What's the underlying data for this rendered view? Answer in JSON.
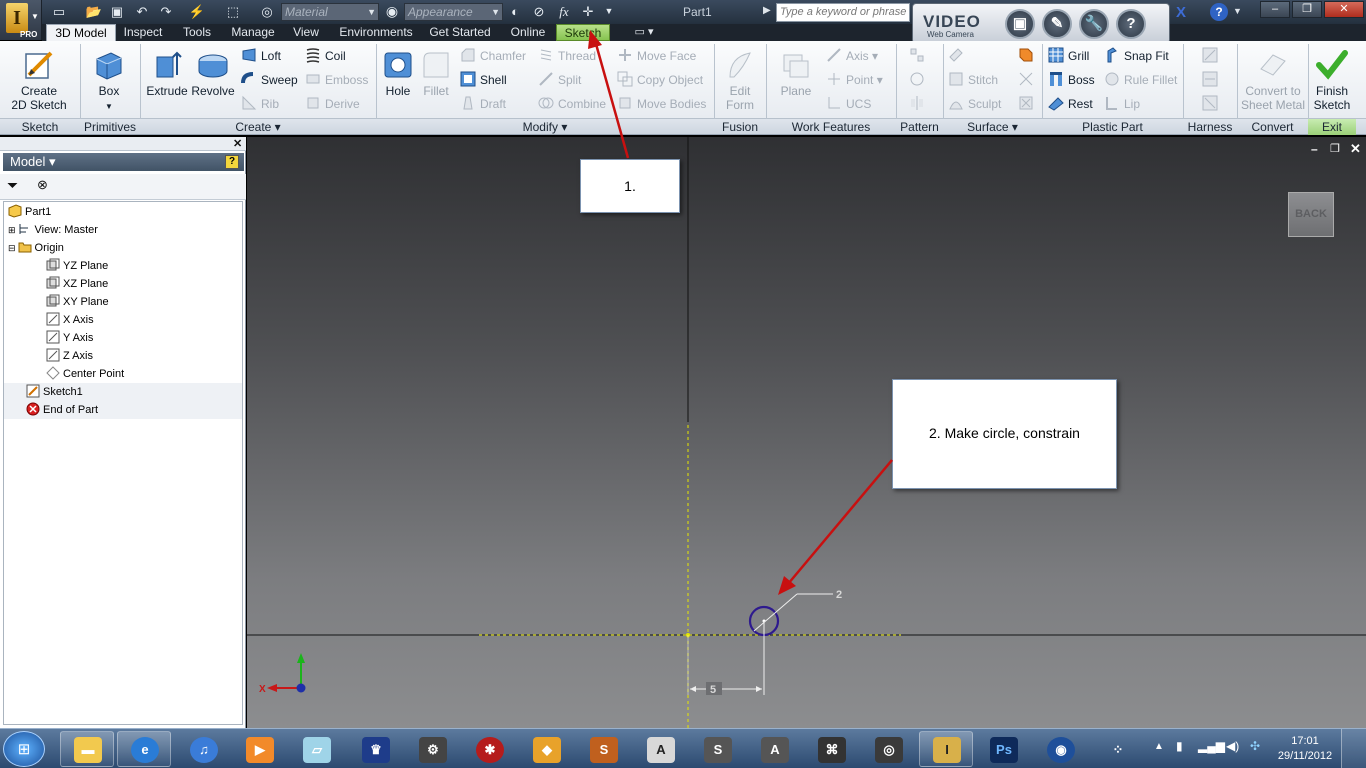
{
  "title_bar": {
    "document_title": "Part1",
    "material_combo": "Material",
    "appearance_combo": "Appearance",
    "fx_label": "fx",
    "search_placeholder": "Type a keyword or phrase"
  },
  "app_badge": {
    "letter": "I",
    "edition": "PRO"
  },
  "video_widget": {
    "title": "VIDEO",
    "subtitle": "Web Camera",
    "help_glyph": "?"
  },
  "tabs": [
    {
      "label": "3D Model",
      "active": true
    },
    {
      "label": "Inspect"
    },
    {
      "label": "Tools"
    },
    {
      "label": "Manage"
    },
    {
      "label": "View"
    },
    {
      "label": "Environments"
    },
    {
      "label": "Get Started"
    },
    {
      "label": "Online"
    },
    {
      "label": "Sketch",
      "contextual": true
    }
  ],
  "ribbon": {
    "panels": [
      "Sketch",
      "Primitives",
      "Create ▾",
      "Modify ▾",
      "Fusion",
      "Work Features",
      "Pattern",
      "Surface ▾",
      "Plastic Part",
      "Harness",
      "Convert",
      "Exit"
    ],
    "create_2d_sketch": "Create\n2D Sketch",
    "box": "Box",
    "extrude": "Extrude",
    "revolve": "Revolve",
    "loft": "Loft",
    "coil": "Coil",
    "sweep": "Sweep",
    "emboss": "Emboss",
    "rib": "Rib",
    "derive": "Derive",
    "hole": "Hole",
    "fillet": "Fillet",
    "chamfer": "Chamfer",
    "thread": "Thread",
    "move_face": "Move Face",
    "shell": "Shell",
    "split": "Split",
    "copy_object": "Copy Object",
    "draft": "Draft",
    "combine": "Combine",
    "move_bodies": "Move Bodies",
    "edit_form": "Edit\nForm",
    "plane": "Plane",
    "axis": "Axis",
    "point": "Point",
    "ucs": "UCS",
    "stitch": "Stitch",
    "sculpt": "Sculpt",
    "grill": "Grill",
    "snap_fit": "Snap Fit",
    "boss": "Boss",
    "rule_fillet": "Rule Fillet",
    "rest": "Rest",
    "lip": "Lip",
    "convert_to_sheet_metal": "Convert to\nSheet Metal",
    "finish_sketch": "Finish\nSketch"
  },
  "browser": {
    "header": "Model ▾",
    "help_glyph": "?",
    "items": [
      {
        "label": "Part1"
      },
      {
        "label": "View: Master"
      },
      {
        "label": "Origin"
      },
      {
        "label": "YZ Plane"
      },
      {
        "label": "XZ Plane"
      },
      {
        "label": "XY Plane"
      },
      {
        "label": "X Axis"
      },
      {
        "label": "Y Axis"
      },
      {
        "label": "Z Axis"
      },
      {
        "label": "Center Point"
      },
      {
        "label": "Sketch1"
      },
      {
        "label": "End of Part"
      }
    ]
  },
  "viewport": {
    "back_label": "BACK",
    "dim_diameter": "2",
    "dim_horizontal": "5",
    "triad_x": "X",
    "annotation_1": "1.",
    "annotation_2": "2. Make circle, constrain"
  },
  "taskbar": {
    "time": "17:01",
    "date": "29/11/2012",
    "ps_label": "Ps"
  },
  "colors": {
    "sketch_tab": "#9bd06a",
    "arrow": "#cc1111",
    "circle": "#3a1e9a",
    "sketch_axis": "#d8d800"
  }
}
